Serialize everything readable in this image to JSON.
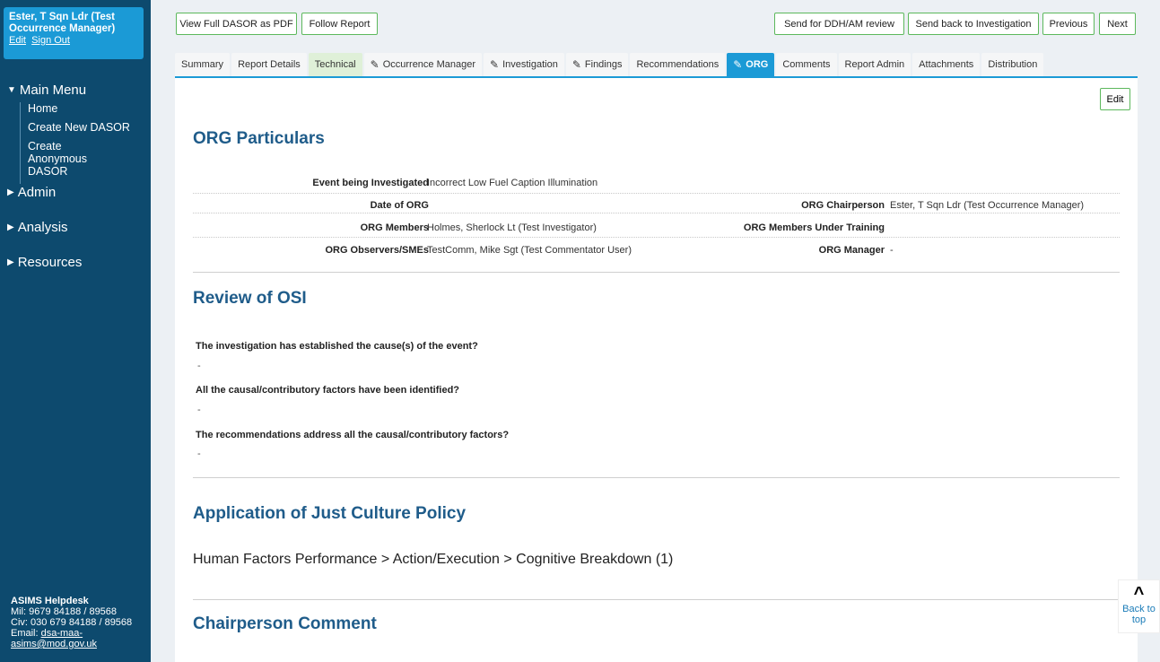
{
  "sidebar": {
    "user_name": "Ester, T Sqn Ldr (Test Occurrence Manager)",
    "edit_link": "Edit",
    "signout_link": "Sign Out",
    "main_menu": "Main Menu",
    "main_items": [
      "Home",
      "Create New DASOR",
      "Create Anonymous DASOR"
    ],
    "admin": "Admin",
    "analysis": "Analysis",
    "resources": "Resources",
    "helpdesk": {
      "title": "ASIMS Helpdesk",
      "mil": "Mil: 9679 84188 / 89568",
      "civ": "Civ: 030 679 84188 / 89568",
      "email_label": "Email: ",
      "email": "dsa-maa-asims@mod.gov.uk"
    }
  },
  "toolbar": {
    "view_pdf": "View Full DASOR as PDF",
    "follow": "Follow Report",
    "send_ddh": "Send for DDH/AM review",
    "send_back": "Send back to Investigation",
    "previous": "Previous",
    "next": "Next"
  },
  "tabs": [
    "Summary",
    "Report Details",
    "Technical",
    "Occurrence Manager",
    "Investigation",
    "Findings",
    "Recommendations",
    "ORG",
    "Comments",
    "Report Admin",
    "Attachments",
    "Distribution"
  ],
  "edit_label": "Edit",
  "particulars": {
    "heading": "ORG Particulars",
    "event_label": "Event being Investigated",
    "event_value": "Incorrect Low Fuel Caption Illumination",
    "date_label": "Date of ORG",
    "date_value": "",
    "chair_label": "ORG Chairperson",
    "chair_value": "Ester, T Sqn Ldr (Test Occurrence Manager)",
    "members_label": "ORG Members",
    "members_value": "Holmes, Sherlock Lt (Test Investigator)",
    "training_label": "ORG Members Under Training",
    "training_value": "",
    "observers_label": "ORG Observers/SMEs",
    "observers_value": "TestComm, Mike Sgt (Test Commentator User)",
    "manager_label": "ORG Manager",
    "manager_value": "-"
  },
  "review": {
    "heading": "Review of OSI",
    "q1": "The investigation has established the cause(s) of the event?",
    "a1": "-",
    "q2": "All the causal/contributory factors have been identified?",
    "a2": "-",
    "q3": "The recommendations address all the causal/contributory factors?",
    "a3": "-"
  },
  "just_culture": {
    "heading": "Application of Just Culture Policy",
    "path": "Human Factors Performance > Action/Execution > Cognitive Breakdown (1)"
  },
  "chair_comment": {
    "heading": "Chairperson Comment"
  },
  "back_to_top": "Back to top"
}
